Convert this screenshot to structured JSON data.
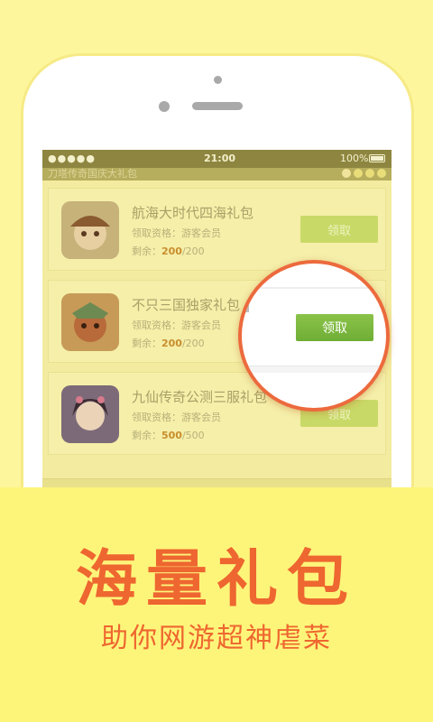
{
  "statusbar": {
    "signal": "●●●●● ",
    "time": "21:00",
    "battery": "100%"
  },
  "screen": {
    "banner": "刀塔传奇国庆大礼包"
  },
  "gifts": [
    {
      "title": "航海大时代四海礼包",
      "qual_label": "领取资格：游客会员",
      "remain_label": "剩余：",
      "remain_num": "200",
      "remain_total": "/200",
      "button": "领取"
    },
    {
      "title": "不只三国独家礼包",
      "qual_label": "领取资格：游客会员",
      "remain_label": "剩余：",
      "remain_num": "200",
      "remain_total": "/200",
      "button": "领取"
    },
    {
      "title": "九仙传奇公测三服礼包",
      "qual_label": "领取资格：游客会员",
      "remain_label": "剩余：",
      "remain_num": "500",
      "remain_total": "/500",
      "button": "领取"
    }
  ],
  "magnifier": {
    "button": "领取"
  },
  "promo": {
    "title": "海量礼包",
    "subtitle": "助你网游超神虐菜"
  },
  "colors": {
    "background": "#fdf69c",
    "accent": "#ee6630",
    "button_green": "#7cb83f"
  }
}
